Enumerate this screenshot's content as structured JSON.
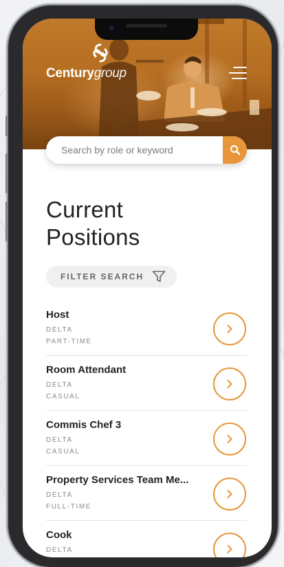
{
  "brand": {
    "name_bold": "Century",
    "name_light": "group",
    "accent": "#e8963a"
  },
  "header": {
    "menu_icon": "hamburger-menu-icon"
  },
  "search": {
    "placeholder": "Search by role or keyword",
    "icon": "search-icon"
  },
  "page": {
    "title_line1": "Current",
    "title_line2": "Positions"
  },
  "filter": {
    "label": "FILTER SEARCH",
    "icon": "filter-funnel-icon"
  },
  "jobs": [
    {
      "title": "Host",
      "location": "DELTA",
      "type": "PART-TIME"
    },
    {
      "title": "Room Attendant",
      "location": "DELTA",
      "type": "CASUAL"
    },
    {
      "title": "Commis Chef 3",
      "location": "DELTA",
      "type": "CASUAL"
    },
    {
      "title": "Property Services Team Me...",
      "location": "DELTA",
      "type": "FULL-TIME"
    },
    {
      "title": "Cook",
      "location": "DELTA",
      "type": ""
    }
  ]
}
